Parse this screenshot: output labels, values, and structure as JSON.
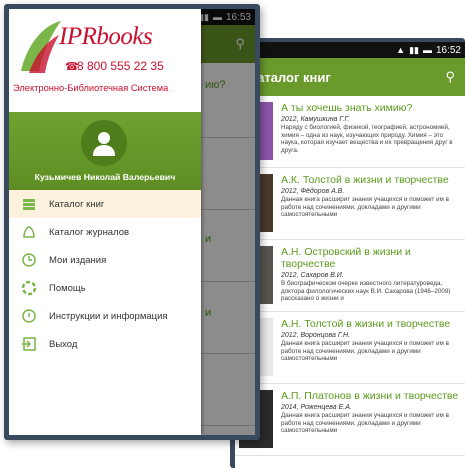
{
  "back_screen": {
    "status_time": "16:52",
    "app_title": "Каталог книг",
    "books": [
      {
        "title": "А ты хочешь знать химию?",
        "meta": "2012, Камушкина Г.Г.",
        "desc": "Наряду с биологией, физикой, географией, астрономией, химия – одна из наук, изучающих природу. Химия – это наука, которая изучает вещества и их превращения друг в друга.",
        "cover_color": "#8c54a8"
      },
      {
        "title": "А.К. Толстой в жизни и творчестве",
        "meta": "2012, Фёдоров А.В.",
        "desc": "Данная книга расширит знания учащихся и поможет им в работе над сочинениями, докладами и другими самостоятельными",
        "cover_color": "#4a3a2e"
      },
      {
        "title": "А.Н. Островский в жизни и творчестве",
        "meta": "2012, Сахаров В.И.",
        "desc": "В биографическом очерке известного литературоведа, доктора филологических наук В.И. Сахарова (1946–2009) рассказано о жизни и",
        "cover_color": "#5a5450"
      },
      {
        "title": "А.Н. Толстой в жизни и творчестве",
        "meta": "2012, Воронцова Г.Н.",
        "desc": "Данная книга расширит знания учащихся и поможет им в работе над сочинениями, докладами и другими самостоятельными",
        "cover_color": "#e9e9e9"
      },
      {
        "title": "А.П. Платонов в жизни и творчестве",
        "meta": "2014, Роженцева Е.А.",
        "desc": "Данная книга расширит знания учащихся и поможет им в работе над сочинениями, докладами и другими самостоятельными",
        "cover_color": "#2b2b2b"
      }
    ]
  },
  "front_screen": {
    "status_time": "16:53",
    "logo": {
      "brand": "IPRbooks",
      "phone": "8 800 555 22 35",
      "subtitle": "Электронно-Библиотечная Система"
    },
    "user_name": "Кузьмичев Николай Валерьевич",
    "menu": [
      {
        "label": "Каталог книг",
        "icon": "catalog-books-icon",
        "active": true
      },
      {
        "label": "Каталог журналов",
        "icon": "catalog-journals-icon",
        "active": false
      },
      {
        "label": "Мои издания",
        "icon": "my-publications-icon",
        "active": false
      },
      {
        "label": "Помощь",
        "icon": "help-icon",
        "active": false
      },
      {
        "label": "Инструкции и информация",
        "icon": "instructions-icon",
        "active": false
      },
      {
        "label": "Выход",
        "icon": "exit-icon",
        "active": false
      }
    ],
    "peek": {
      "t1": "ию?",
      "t2": "и",
      "t3": "и"
    },
    "accent_color": "#6b9a2c",
    "brand_color": "#c8102e"
  }
}
